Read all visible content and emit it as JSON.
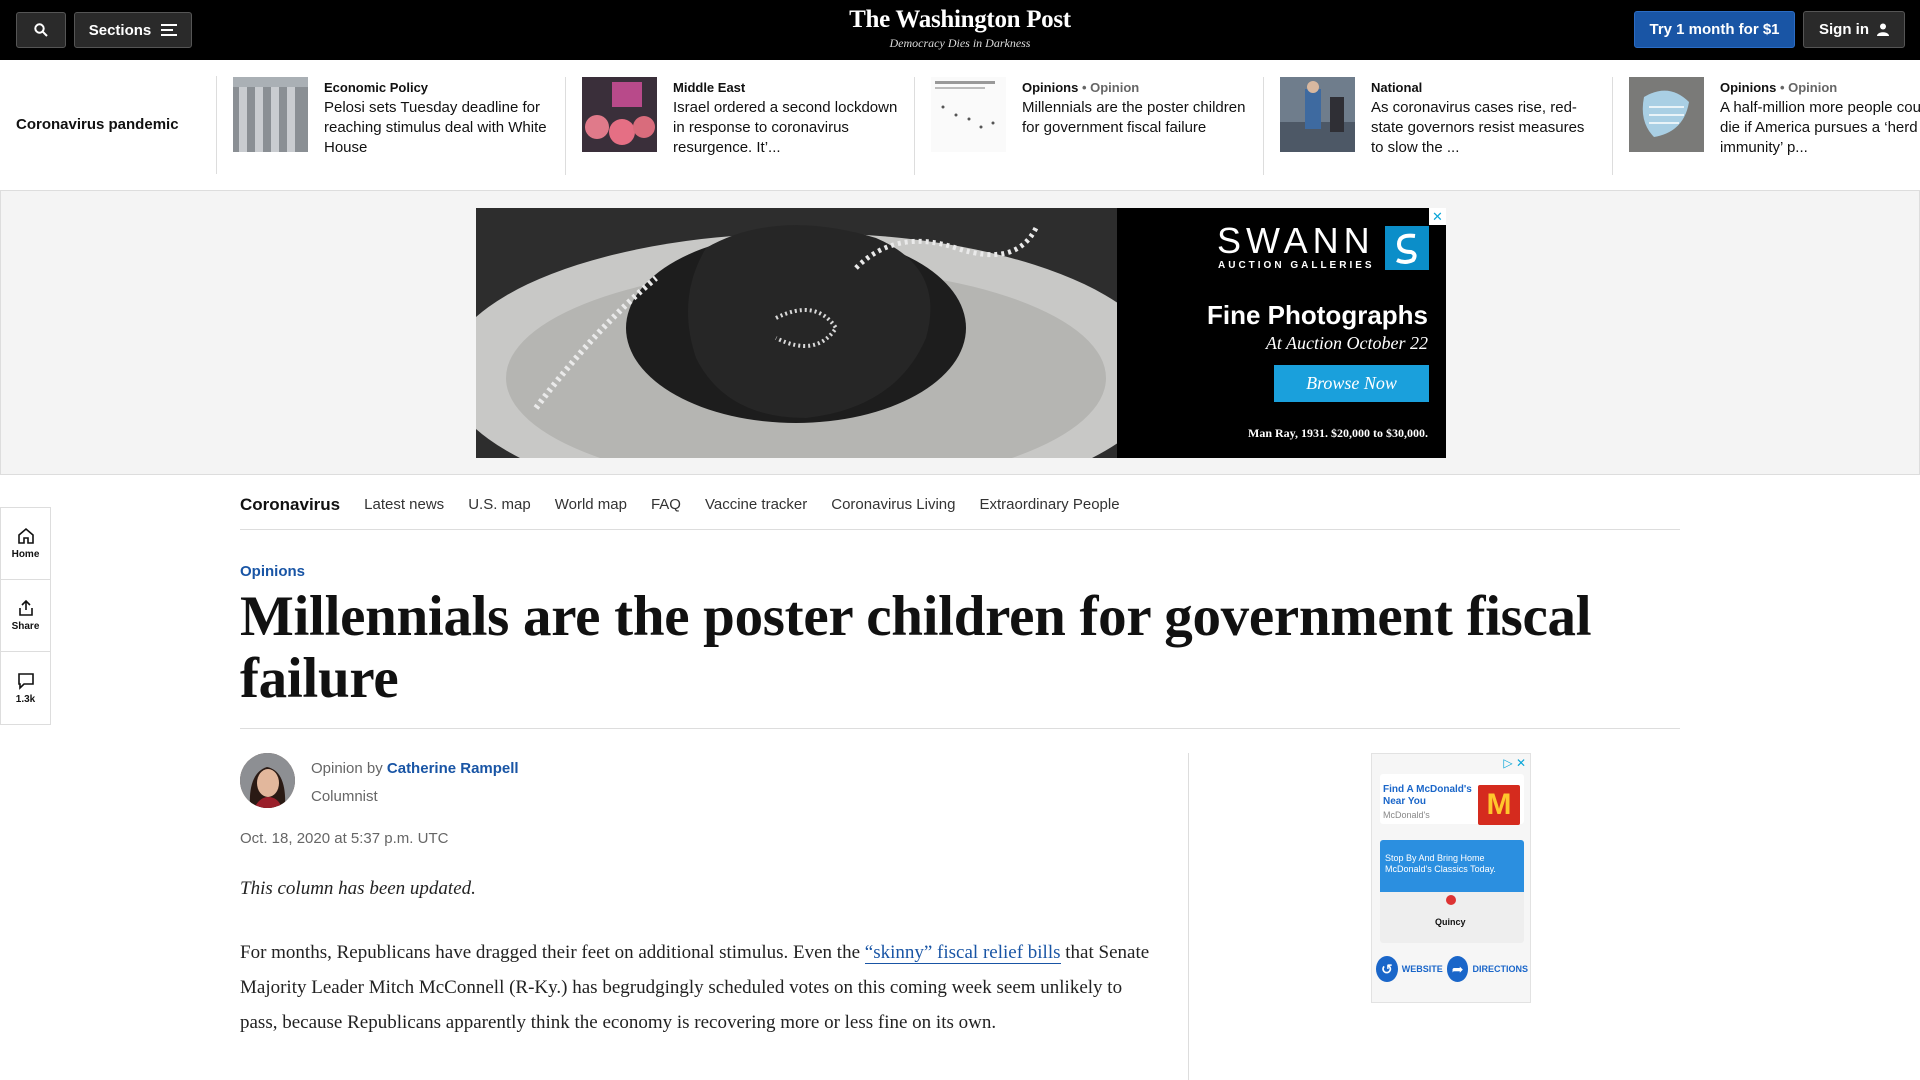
{
  "topbar": {
    "sections_label": "Sections",
    "logo_name": "The Washington Post",
    "logo_tagline": "Democracy Dies in Darkness",
    "try_label": "Try 1 month for $1",
    "signin_label": "Sign in"
  },
  "strip": {
    "label": "Coronavirus pandemic",
    "stories": [
      {
        "kicker": "Economic Policy",
        "opinion": "",
        "headline": "Pelosi sets Tuesday deadline for reaching stimulus deal with White House"
      },
      {
        "kicker": "Middle East",
        "opinion": "",
        "headline": "Israel ordered a second lockdown in response to coronavirus resurgence. It’..."
      },
      {
        "kicker": "Opinions",
        "opinion": " • Opinion",
        "headline": "Millennials are the poster children for government fiscal failure"
      },
      {
        "kicker": "National",
        "opinion": "",
        "headline": "As coronavirus cases rise, red-state governors resist measures to slow the ..."
      },
      {
        "kicker": "Opinions",
        "opinion": " • Opinion",
        "headline": "A half-million more people could die if America pursues a ‘herd immunity’ p..."
      }
    ]
  },
  "banner_ad": {
    "brand": "SWANN",
    "brand_sub": "AUCTION GALLERIES",
    "title": "Fine Photographs",
    "subtitle": "At Auction October 22",
    "cta": "Browse Now",
    "caption": "Man Ray, 1931. $20,000 to $30,000."
  },
  "rail": {
    "home": "Home",
    "share": "Share",
    "comments": "1.3k"
  },
  "subnav": {
    "title": "Coronavirus",
    "links": [
      "Latest news",
      "U.S. map",
      "World map",
      "FAQ",
      "Vaccine tracker",
      "Coronavirus Living",
      "Extraordinary People"
    ]
  },
  "article": {
    "kicker": "Opinions",
    "headline": "Millennials are the poster children for government fiscal failure",
    "byline_prefix": "Opinion by ",
    "author": "Catherine Rampell",
    "role": "Columnist",
    "date": "Oct. 18, 2020 at 5:37 p.m. UTC",
    "note": "This column has been updated.",
    "para_before": "For months, Republicans have dragged their feet on additional stimulus. Even the ",
    "para_link": "“skinny” fiscal relief bills",
    "para_after": " that Senate Majority Leader Mitch McConnell (R-Ky.) has begrudgingly scheduled votes on this coming week seem unlikely to pass, because Republicans apparently think the economy is recovering more or less fine on its own."
  },
  "side_ad": {
    "card_title": "Find A McDonald's Near You",
    "card_source": "McDonald's",
    "blue_text": "Stop By And Bring Home McDonald's Classics Today.",
    "map_label": "Quincy",
    "website": "WEBSITE",
    "directions": "DIRECTIONS"
  },
  "colors": {
    "accent": "#1955a5",
    "topbar": "#000000",
    "ad_cta": "#1aa0dc",
    "mcdonalds_red": "#d52b1e"
  }
}
